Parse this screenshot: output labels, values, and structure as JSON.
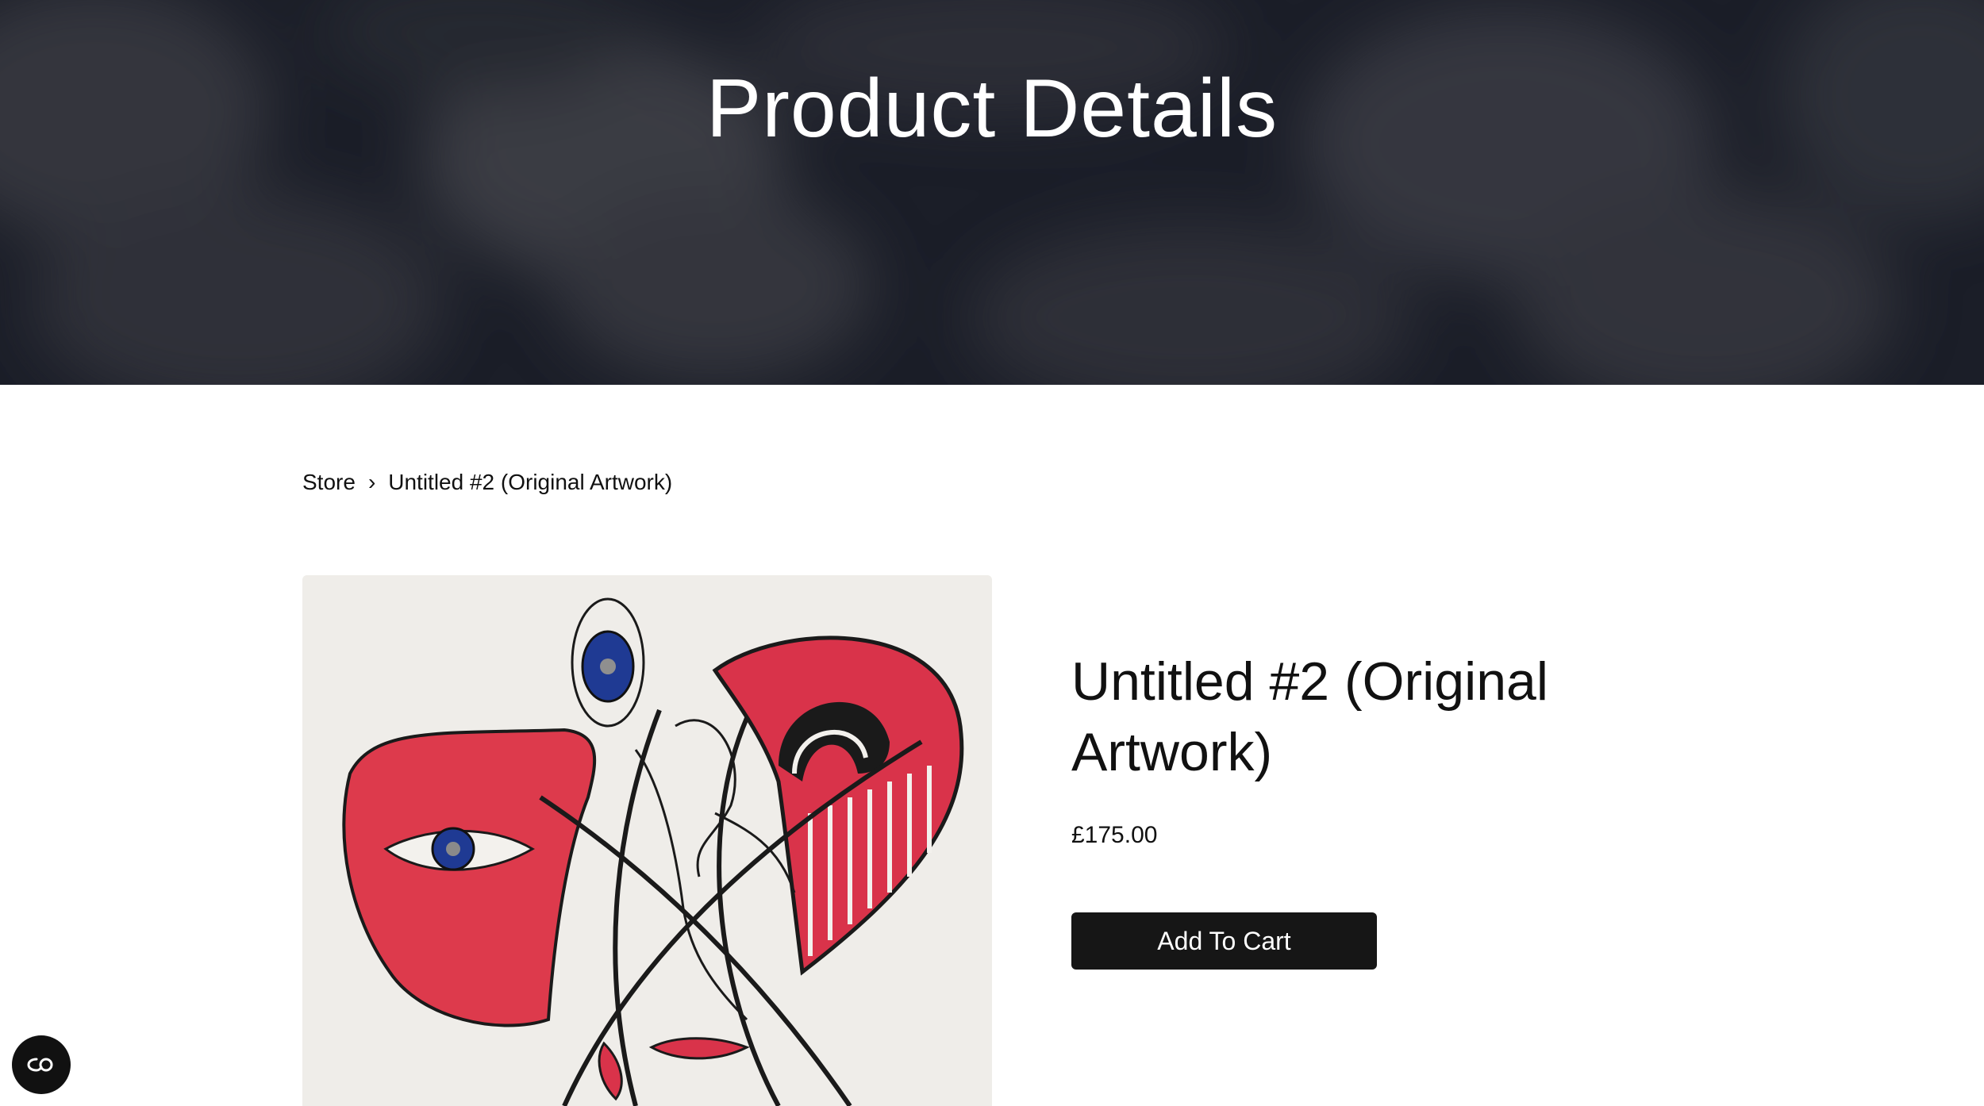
{
  "hero": {
    "title": "Product Details"
  },
  "breadcrumb": {
    "items": [
      "Store",
      "Untitled #2 (Original Artwork)"
    ],
    "separator": "›"
  },
  "product": {
    "title": "Untitled #2 (Original Artwork)",
    "price": "£175.00",
    "add_to_cart_label": "Add To Cart",
    "image_alt": "abstract-face-artwork"
  },
  "colors": {
    "hero_bg": "#1a1d27",
    "button_bg": "#161616",
    "artwork_red": "#d9334a",
    "artwork_blue": "#1f3a93",
    "artwork_bg": "#efede9"
  },
  "accessibility": {
    "icon": "accessibility-toggle-icon"
  }
}
